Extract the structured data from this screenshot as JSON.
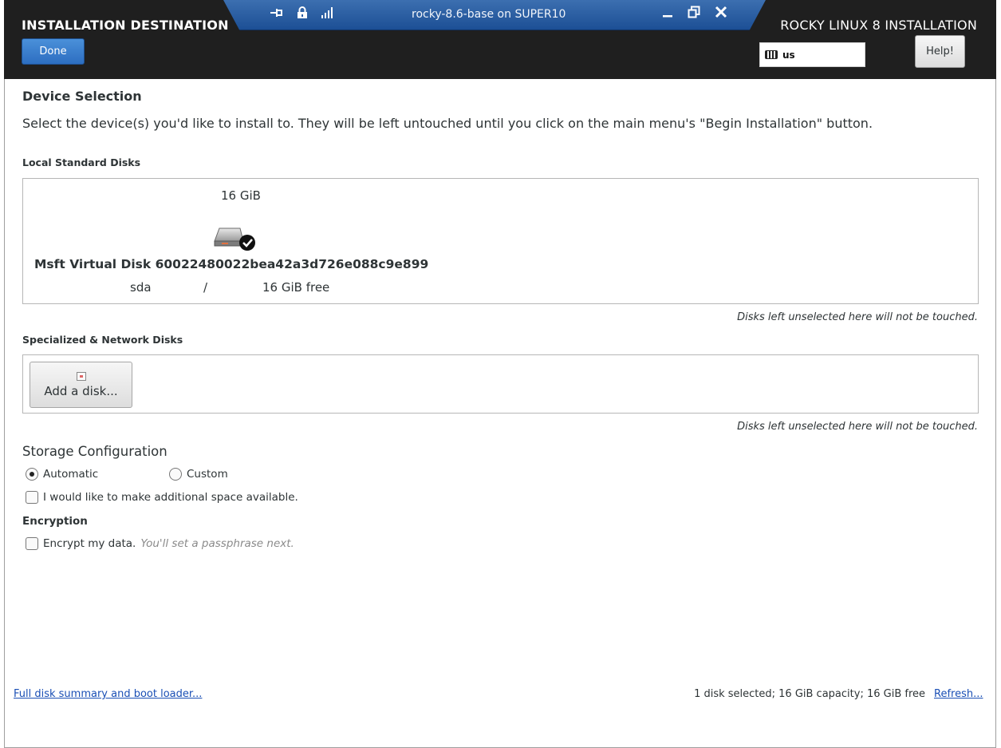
{
  "header": {
    "page_title": "INSTALLATION DESTINATION",
    "product_title": "ROCKY LINUX 8 INSTALLATION",
    "done_label": "Done",
    "keyboard_layout": "us",
    "help_label": "Help!"
  },
  "remote_bar": {
    "title": "rocky-8.6-base on SUPER10",
    "icons": [
      "pin-icon",
      "lock-icon",
      "signal-icon",
      "minimize-icon",
      "restore-icon",
      "close-icon"
    ]
  },
  "device_selection": {
    "title": "Device Selection",
    "description": "Select the device(s) you'd like to install to.  They will be left untouched until you click on the main menu's \"Begin Installation\" button."
  },
  "local_disks": {
    "label": "Local Standard Disks",
    "disks": [
      {
        "size": "16 GiB",
        "name": "Msft Virtual Disk 60022480022bea42a3d726e088c9e899",
        "device": "sda",
        "mount": "/",
        "free": "16 GiB free",
        "selected": true
      }
    ],
    "note": "Disks left unselected here will not be touched."
  },
  "network_disks": {
    "label": "Specialized & Network Disks",
    "add_button": "Add a disk...",
    "note": "Disks left unselected here will not be touched."
  },
  "storage_config": {
    "title": "Storage Configuration",
    "options": [
      {
        "label": "Automatic",
        "selected": true
      },
      {
        "label": "Custom",
        "selected": false
      }
    ],
    "additional_space": "I would like to make additional space available."
  },
  "encryption": {
    "title": "Encryption",
    "checkbox_label": "Encrypt my data.",
    "hint": "You'll set a passphrase next."
  },
  "footer": {
    "summary_link": "Full disk summary and boot loader...",
    "status": "1 disk selected; 16 GiB capacity; 16 GiB free",
    "refresh_link": "Refresh..."
  },
  "colors": {
    "header_bg": "#1f1f1f",
    "accent_blue": "#2d6ec1",
    "remote_bar": "#2a5ea6",
    "link": "#1a4fb5"
  }
}
